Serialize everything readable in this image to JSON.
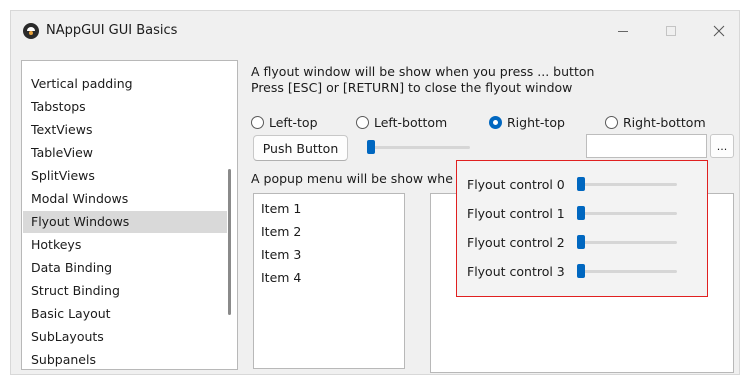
{
  "window": {
    "title": "NAppGUI GUI Basics"
  },
  "sidebar": {
    "items": [
      {
        "label": "Vertical padding"
      },
      {
        "label": "Tabstops"
      },
      {
        "label": "TextViews"
      },
      {
        "label": "TableView"
      },
      {
        "label": "SplitViews"
      },
      {
        "label": "Modal Windows"
      },
      {
        "label": "Flyout Windows"
      },
      {
        "label": "Hotkeys"
      },
      {
        "label": "Data Binding"
      },
      {
        "label": "Struct Binding"
      },
      {
        "label": "Basic Layout"
      },
      {
        "label": "SubLayouts"
      },
      {
        "label": "Subpanels"
      }
    ],
    "selected": "Flyout Windows"
  },
  "main": {
    "info_line1": "A flyout window will be show when you press ... button",
    "info_line2": "Press [ESC] or [RETURN] to close the flyout window",
    "radios": [
      {
        "label": "Left-top",
        "checked": false
      },
      {
        "label": "Left-bottom",
        "checked": false
      },
      {
        "label": "Right-top",
        "checked": true
      },
      {
        "label": "Right-bottom",
        "checked": false
      }
    ],
    "push_button": "Push Button",
    "slider_value": 0.0,
    "text_value": "",
    "dots_button": "...",
    "popup_label": "A popup menu will be show whe",
    "popup_items": [
      {
        "label": "Item 1"
      },
      {
        "label": "Item 2"
      },
      {
        "label": "Item 3"
      },
      {
        "label": "Item 4"
      }
    ]
  },
  "flyout": {
    "rows": [
      {
        "label": "Flyout control 0",
        "value": 0.0
      },
      {
        "label": "Flyout control 1",
        "value": 0.0
      },
      {
        "label": "Flyout control 2",
        "value": 0.0
      },
      {
        "label": "Flyout control 3",
        "value": 0.0
      }
    ]
  },
  "colors": {
    "accent": "#0067c0",
    "flyout_border": "#e02020",
    "selection": "#d9d9d9"
  },
  "icons": {
    "app": "nappgui-logo-icon",
    "minimize": "minimize-icon",
    "maximize": "maximize-icon",
    "close": "close-icon"
  }
}
